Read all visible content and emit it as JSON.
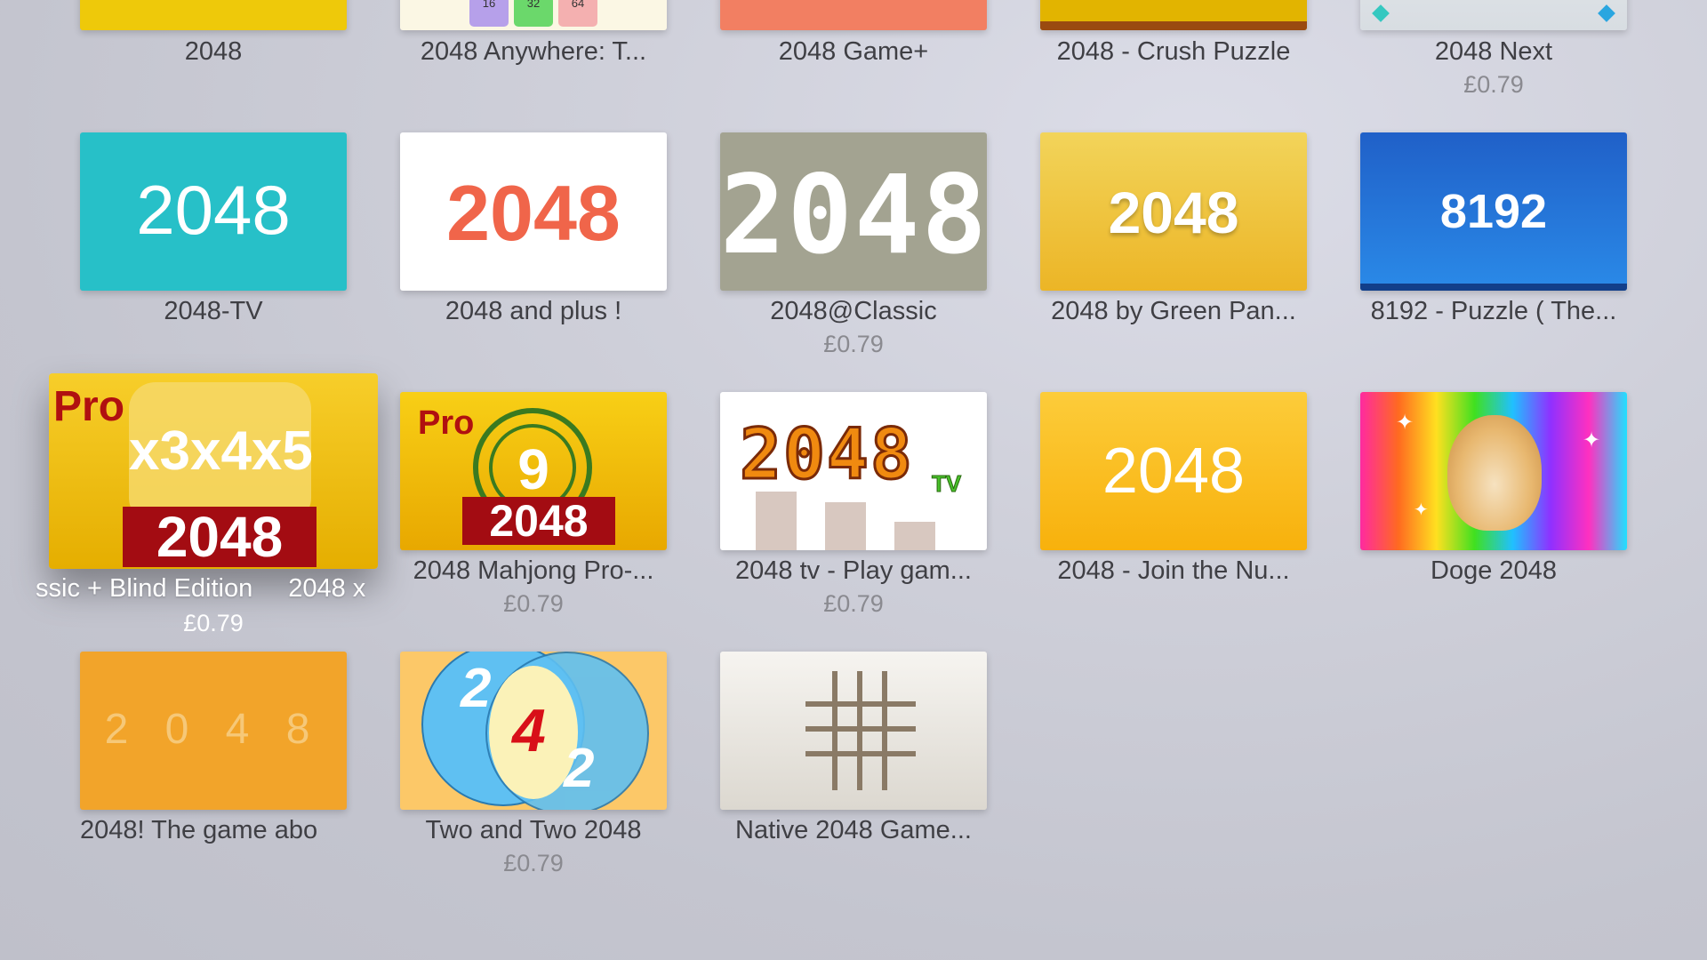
{
  "apps": [
    {
      "title": "2048",
      "price": ""
    },
    {
      "title": "2048 Anywhere: T...",
      "price": "",
      "tile_numbers": [
        "16",
        "32",
        "64"
      ]
    },
    {
      "title": "2048 Game+",
      "price": ""
    },
    {
      "title": "2048 - Crush Puzzle",
      "price": ""
    },
    {
      "title": "2048 Next",
      "price": "£0.79"
    },
    {
      "title": "2048-TV",
      "price": "",
      "icon_text": "2048"
    },
    {
      "title": "2048 and plus !",
      "price": "",
      "icon_text": "2048"
    },
    {
      "title": "2048@Classic",
      "price": "£0.79",
      "icon_text": "2048"
    },
    {
      "title": "2048 by Green Pan...",
      "price": "",
      "icon_text": "2048"
    },
    {
      "title": "8192 - Puzzle ( The...",
      "price": "",
      "icon_text": "8192"
    },
    {
      "title_left": "ssic + Blind Edition",
      "title_right": "2048 x",
      "price": "£0.79",
      "icon_badge": "Pro",
      "icon_sizes": "x3x4x5",
      "icon_text": "2048"
    },
    {
      "title": "2048 Mahjong Pro-...",
      "price": "£0.79",
      "icon_badge": "Pro",
      "icon_number": "9",
      "icon_text": "2048"
    },
    {
      "title": "2048 tv - Play gam...",
      "price": "£0.79",
      "icon_text": "2048",
      "icon_sub": "TV"
    },
    {
      "title": "2048 - Join the Nu...",
      "price": "",
      "icon_text": "2048"
    },
    {
      "title": "Doge 2048",
      "price": ""
    },
    {
      "title": "2048! The game abo",
      "price": "",
      "icon_text": "2 0 4 8"
    },
    {
      "title": "Two and Two 2048",
      "price": "£0.79",
      "icon_digits": [
        "2",
        "4",
        "2"
      ]
    },
    {
      "title": "Native 2048 Game...",
      "price": ""
    }
  ],
  "colors": {
    "tile_teal": "#27c0c8",
    "tile_red_text": "#f0654a",
    "tile_gray": "#a3a391",
    "tile_blue": "#1f66d0",
    "tile_orange": "#f2a42a"
  }
}
